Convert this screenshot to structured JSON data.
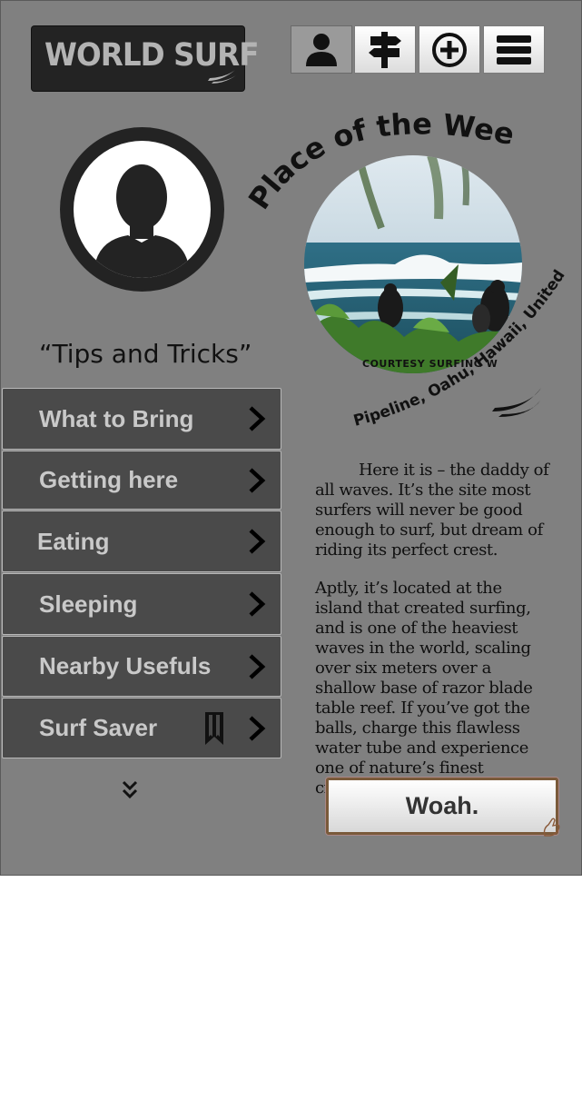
{
  "app": {
    "logo_text": "WORLD SURF",
    "colors": {
      "background": "#808080",
      "menu_bg": "#4a4a4a",
      "menu_text": "#c9c9c9",
      "dark": "#232323"
    }
  },
  "nav": [
    {
      "name": "profile",
      "icon": "person-icon",
      "active": true
    },
    {
      "name": "directions",
      "icon": "signpost-icon",
      "active": false
    },
    {
      "name": "add",
      "icon": "plus-circle-icon",
      "active": false
    },
    {
      "name": "menu",
      "icon": "hamburger-icon",
      "active": false
    }
  ],
  "tips": {
    "title": "“Tips and Tricks”",
    "items": [
      {
        "label": "What to Bring"
      },
      {
        "label": "Getting here"
      },
      {
        "label": "Eating"
      },
      {
        "label": "Sleeping"
      },
      {
        "label": "Nearby Usefuls"
      },
      {
        "label": "Surf Saver",
        "icon": "bookmark-icon"
      }
    ],
    "more_icon": "double-chevron-down-icon"
  },
  "place": {
    "heading": "Place of the Week",
    "location": "Pipeline, Oahu, Hawaii, United States",
    "photo_caption": "COURTESY SURFING W",
    "paragraphs": [
      "Here it is – the daddy of all waves. It’s the site most surfers will never be good enough to surf, but dream of riding its perfect crest.",
      "Aptly, it’s located at the island that created surfing, and is one of the heaviest waves in the world, scaling over six meters over a shallow base of razor blade table reef. If you’ve got the balls, charge this flawless water tube and experience one of nature’s finest creations."
    ],
    "button_label": "Woah."
  }
}
